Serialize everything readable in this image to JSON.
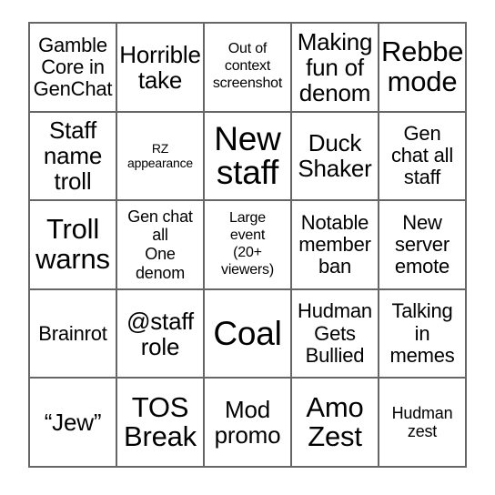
{
  "card": {
    "type": "bingo-card",
    "rows": 5,
    "columns": 5,
    "border_color": "#666666",
    "background_color": "#ffffff",
    "text_color": "#000000",
    "cells": [
      {
        "id": "r1c1",
        "text": "Gamble\nCore in\nGenChat",
        "size": "m"
      },
      {
        "id": "r1c2",
        "text": "Horrible\ntake",
        "size": "l"
      },
      {
        "id": "r1c3",
        "text": "Out of\ncontext\nscreenshot",
        "size": "xs"
      },
      {
        "id": "r1c4",
        "text": "Making\nfun of\ndenom",
        "size": "l"
      },
      {
        "id": "r1c5",
        "text": "Rebbe\nmode",
        "size": "xl"
      },
      {
        "id": "r2c1",
        "text": "Staff\nname\ntroll",
        "size": "l"
      },
      {
        "id": "r2c2",
        "text": "RZ\nappearance",
        "size": "xxs"
      },
      {
        "id": "r2c3",
        "text": "New\nstaff",
        "size": "xxl"
      },
      {
        "id": "r2c4",
        "text": "Duck\nShaker",
        "size": "l"
      },
      {
        "id": "r2c5",
        "text": "Gen\nchat all\nstaff",
        "size": "m"
      },
      {
        "id": "r3c1",
        "text": "Troll\nwarns",
        "size": "xl"
      },
      {
        "id": "r3c2",
        "text": "Gen chat\nall\nOne\ndenom",
        "size": "s"
      },
      {
        "id": "r3c3",
        "text": "Large\nevent\n(20+\nviewers)",
        "size": "xs"
      },
      {
        "id": "r3c4",
        "text": "Notable\nmember\nban",
        "size": "m"
      },
      {
        "id": "r3c5",
        "text": "New\nserver\nemote",
        "size": "m"
      },
      {
        "id": "r4c1",
        "text": "Brainrot",
        "size": "m"
      },
      {
        "id": "r4c2",
        "text": "@staff\nrole",
        "size": "l"
      },
      {
        "id": "r4c3",
        "text": "Coal",
        "size": "xxl"
      },
      {
        "id": "r4c4",
        "text": "Hudman\nGets\nBullied",
        "size": "m"
      },
      {
        "id": "r4c5",
        "text": "Talking\nin\nmemes",
        "size": "m"
      },
      {
        "id": "r5c1",
        "text": "“Jew”",
        "size": "l"
      },
      {
        "id": "r5c2",
        "text": "TOS\nBreak",
        "size": "xl"
      },
      {
        "id": "r5c3",
        "text": "Mod\npromo",
        "size": "l"
      },
      {
        "id": "r5c4",
        "text": "Amo\nZest",
        "size": "xl"
      },
      {
        "id": "r5c5",
        "text": "Hudman\nzest",
        "size": "s"
      }
    ]
  }
}
